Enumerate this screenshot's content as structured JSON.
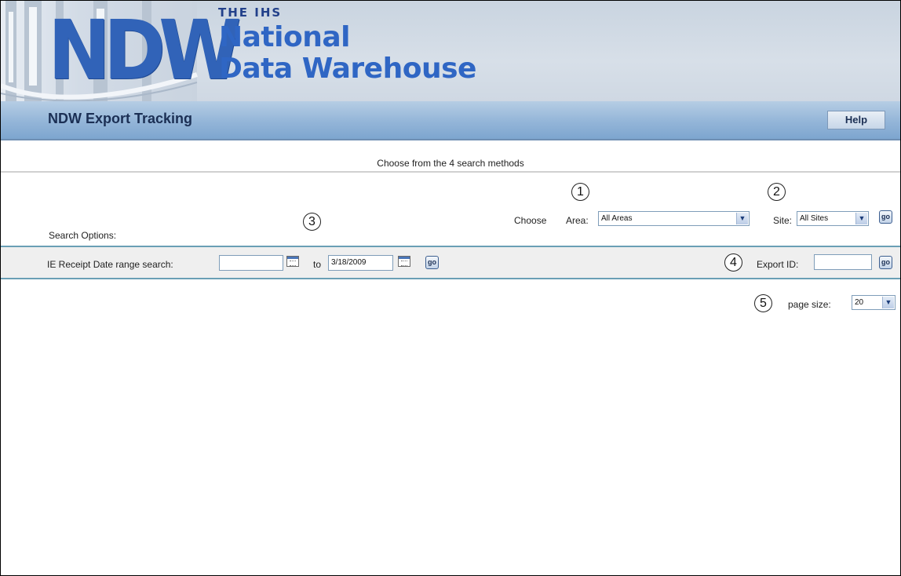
{
  "banner": {
    "logo_mark": "NDW",
    "logo_superscript": "THE IHS",
    "logo_line1": "National",
    "logo_line2": "Data Warehouse"
  },
  "header": {
    "title": "NDW Export Tracking",
    "help_label": "Help"
  },
  "instructions": "Choose from the 4 search methods",
  "search_options_label": "Search Options:",
  "markers": {
    "m1": "1",
    "m2": "2",
    "m3": "3",
    "m4": "4",
    "m5": "5"
  },
  "area_filter": {
    "choose_label": "Choose",
    "area_label": "Area:",
    "area_value": "All Areas",
    "site_label": "Site:",
    "site_value": "All Sites",
    "go_label": "go"
  },
  "date_search": {
    "label": "IE Receipt Date range search:",
    "from_value": "",
    "to_label": "to",
    "to_value": "3/18/2009",
    "go_label": "go"
  },
  "export_search": {
    "label": "Export ID:",
    "value": "",
    "go_label": "go"
  },
  "paging": {
    "page_size_label": "page size:",
    "page_size_value": "20"
  },
  "icons": {
    "calendar": "calendar-icon",
    "dropdown": "chevron-down-icon"
  },
  "colors": {
    "logo_blue": "#2f66c4",
    "title_bar": "#93b5d8",
    "separator_teal": "#6a9fb5"
  }
}
